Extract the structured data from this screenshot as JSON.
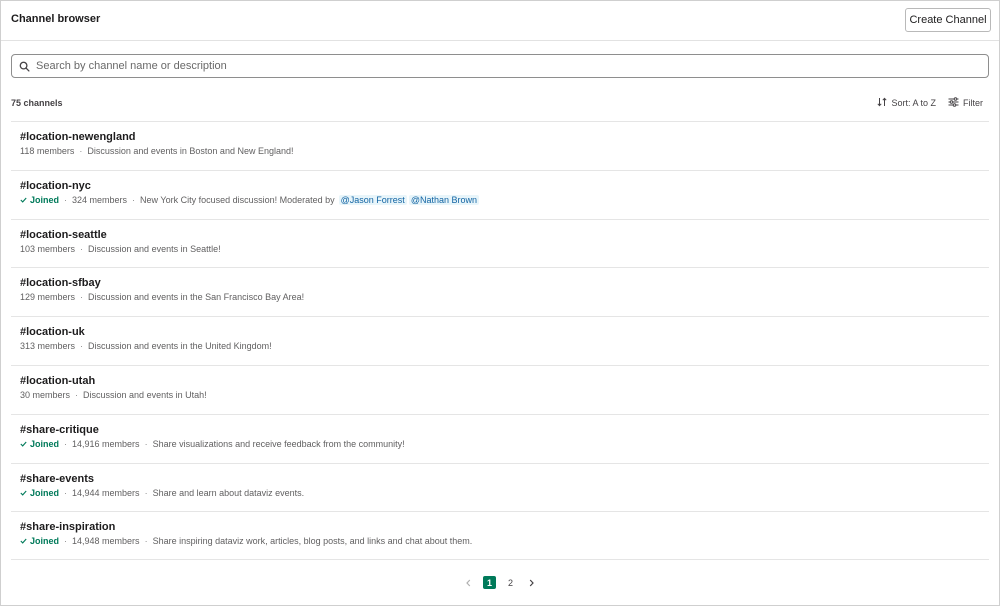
{
  "header": {
    "title": "Channel browser",
    "create_label": "Create Channel"
  },
  "search": {
    "placeholder": "Search by channel name or description",
    "value": ""
  },
  "list_header": {
    "count": "75 channels",
    "sort_label": "Sort: A to Z",
    "filter_label": "Filter"
  },
  "joined_label": "Joined",
  "channels": [
    {
      "name": "#location-newengland",
      "joined": false,
      "members": "118 members",
      "description": "Discussion and events in Boston and New England!"
    },
    {
      "name": "#location-nyc",
      "joined": true,
      "members": "324 members",
      "description": "New York City focused discussion! Moderated by",
      "mentions": [
        "@Jason Forrest",
        "@Nathan Brown"
      ]
    },
    {
      "name": "#location-seattle",
      "joined": false,
      "members": "103 members",
      "description": "Discussion and events in Seattle!"
    },
    {
      "name": "#location-sfbay",
      "joined": false,
      "members": "129 members",
      "description": "Discussion and events in the San Francisco Bay Area!"
    },
    {
      "name": "#location-uk",
      "joined": false,
      "members": "313 members",
      "description": "Discussion and events in the United Kingdom!"
    },
    {
      "name": "#location-utah",
      "joined": false,
      "members": "30 members",
      "description": "Discussion and events in Utah!"
    },
    {
      "name": "#share-critique",
      "joined": true,
      "members": "14,916 members",
      "description": "Share visualizations and receive feedback from the community!"
    },
    {
      "name": "#share-events",
      "joined": true,
      "members": "14,944 members",
      "description": "Share and learn about dataviz events."
    },
    {
      "name": "#share-inspiration",
      "joined": true,
      "members": "14,948 members",
      "description": "Share inspiring dataviz work, articles, blog posts, and links and chat about them."
    }
  ],
  "pagination": {
    "pages": [
      "1",
      "2"
    ],
    "current": "1"
  },
  "colors": {
    "accent_green": "#007a5a",
    "mention_blue": "#1264a3",
    "mention_bg": "#e8f5fa"
  },
  "icons": {
    "search": "search-icon",
    "sort": "sort-icon",
    "filter": "filter-icon",
    "check": "check-icon",
    "prev": "chevron-left-icon",
    "next": "chevron-right-icon"
  }
}
